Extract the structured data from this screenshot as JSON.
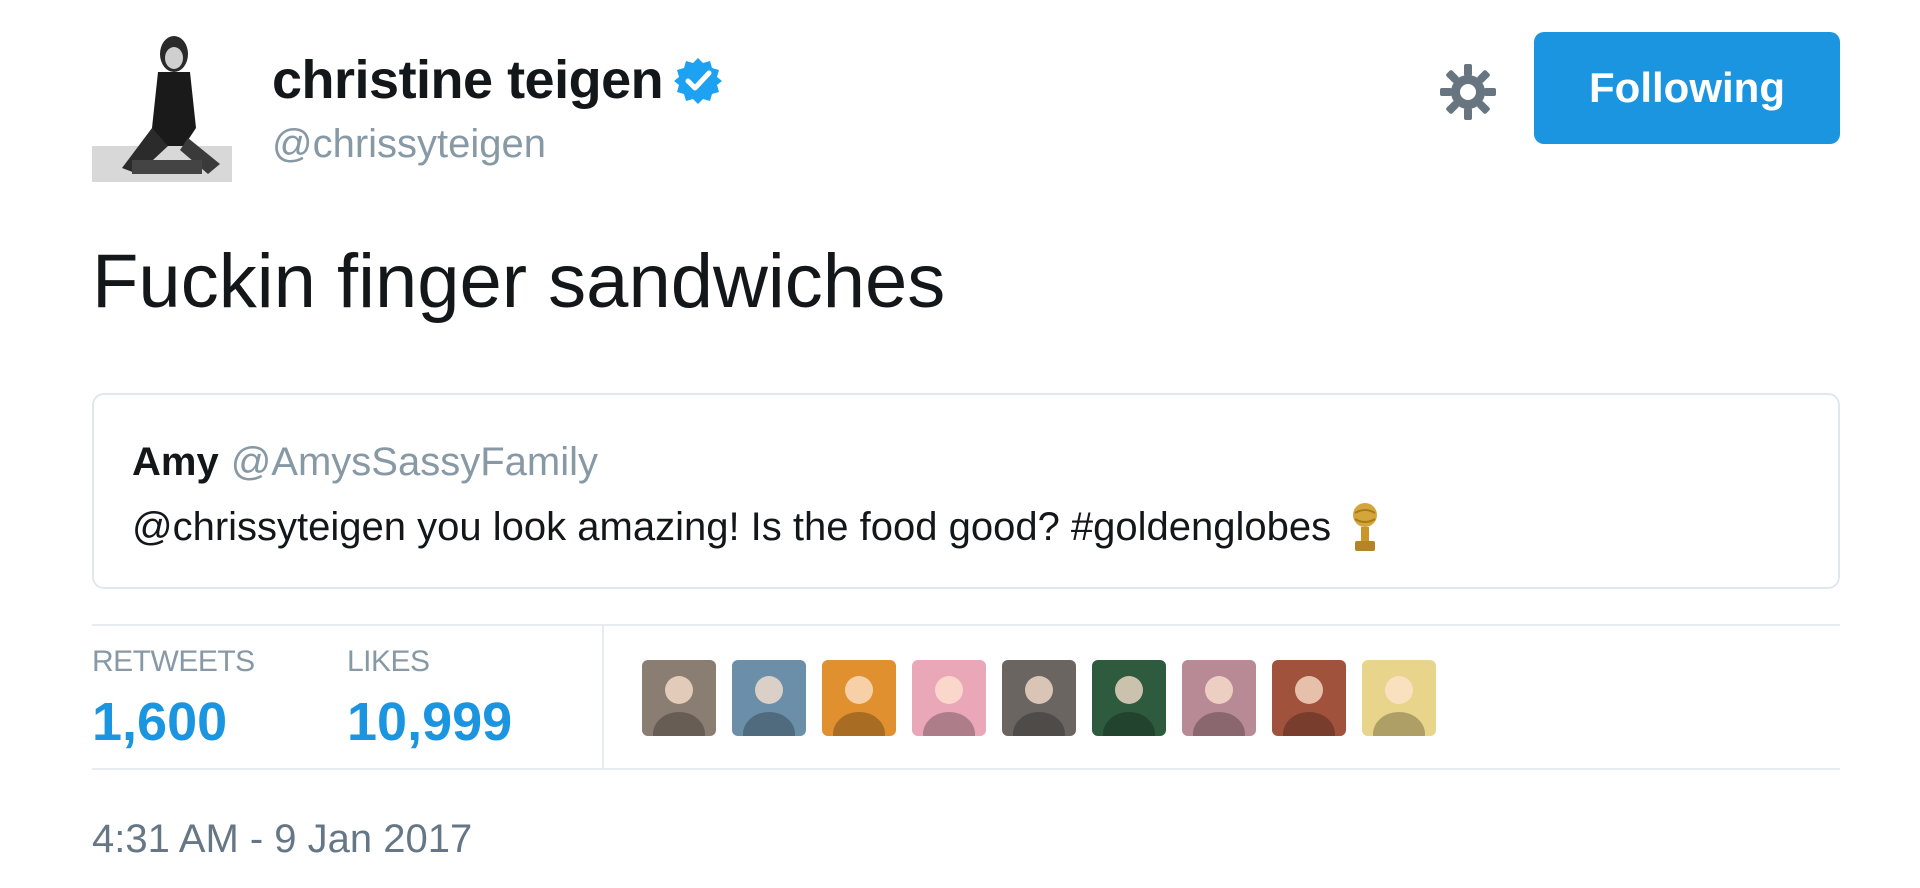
{
  "author": {
    "display_name": "christine teigen",
    "handle": "@chrissyteigen",
    "verified_icon": "verified-badge-icon",
    "avatar_icon": "avatar-photo"
  },
  "actions": {
    "settings_icon": "gear-icon",
    "follow_label": "Following",
    "follow_color": "#1b95e0"
  },
  "tweet": {
    "text": "Fuckin finger sandwiches"
  },
  "quoted_tweet": {
    "name": "Amy",
    "handle": "@AmysSassyFamily",
    "text": "@chrissyteigen you look amazing! Is the food good? #goldenglobes",
    "emoji_icon": "golden-globe-icon"
  },
  "stats": {
    "retweets_label": "RETWEETS",
    "retweets_value": "1,600",
    "likes_label": "LIKES",
    "likes_value": "10,999",
    "value_color": "#1b95e0"
  },
  "likers": [
    {
      "icon": "liker-avatar-1",
      "color": "#8a7d72"
    },
    {
      "icon": "liker-avatar-2",
      "color": "#6b8fa8"
    },
    {
      "icon": "liker-avatar-3",
      "color": "#e0902e"
    },
    {
      "icon": "liker-avatar-4",
      "color": "#e9a7b8"
    },
    {
      "icon": "liker-avatar-5",
      "color": "#6a6560"
    },
    {
      "icon": "liker-avatar-6",
      "color": "#2e5a3e"
    },
    {
      "icon": "liker-avatar-7",
      "color": "#b88a95"
    },
    {
      "icon": "liker-avatar-8",
      "color": "#a0523c"
    },
    {
      "icon": "liker-avatar-9",
      "color": "#e8d48a"
    }
  ],
  "timestamp": "4:31 AM - 9 Jan 2017"
}
